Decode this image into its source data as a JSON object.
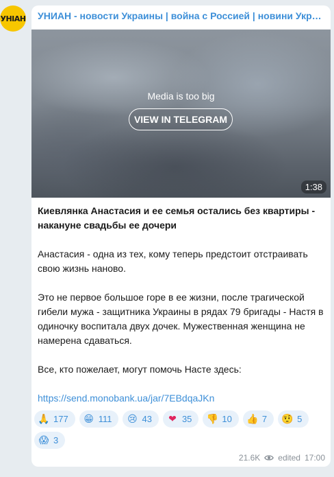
{
  "channel": {
    "avatar_text": "УНІАН",
    "title": "УНИАН - новости Украины | война с Россией | новини України | Ukraine News",
    "accent": "#3d8fd8"
  },
  "media": {
    "message": "Media is too big",
    "button_label": "VIEW IN TELEGRAM",
    "duration": "1:38"
  },
  "post": {
    "headline": "Киевлянка Анастасия и ее семья остались без квартиры - накануне свадьбы ее дочери",
    "paragraph1": "Анастасия - одна из тех, кому теперь предстоит отстраивать свою жизнь наново.",
    "paragraph2": "Это не первое большое горе в ее жизни, после трагической гибели мужа - защитника Украины в рядах 79 бригады - Настя в одиночку воспитала двух дочек. Мужественная женщина не намерена сдаваться.",
    "paragraph3": "Все, кто пожелает, могут помочь Насте здесь:",
    "link": "https://send.monobank.ua/jar/7EBdqaJKn"
  },
  "reactions": [
    {
      "emoji": "🙏",
      "icon": "pray-icon",
      "count": "177"
    },
    {
      "emoji": "😁",
      "icon": "grin-icon",
      "count": "111"
    },
    {
      "emoji": "😢",
      "icon": "cry-icon",
      "count": "43"
    },
    {
      "emoji": "❤",
      "icon": "heart-icon",
      "count": "35"
    },
    {
      "emoji": "👎",
      "icon": "thumbs-down-icon",
      "count": "10"
    },
    {
      "emoji": "👍",
      "icon": "thumbs-up-icon",
      "count": "7"
    },
    {
      "emoji": "🤨",
      "icon": "raised-eyebrow-icon",
      "count": "5"
    },
    {
      "emoji": "😱",
      "icon": "scream-icon",
      "count": "3"
    }
  ],
  "footer": {
    "views": "21.6K",
    "edited_label": "edited",
    "time": "17:00"
  }
}
